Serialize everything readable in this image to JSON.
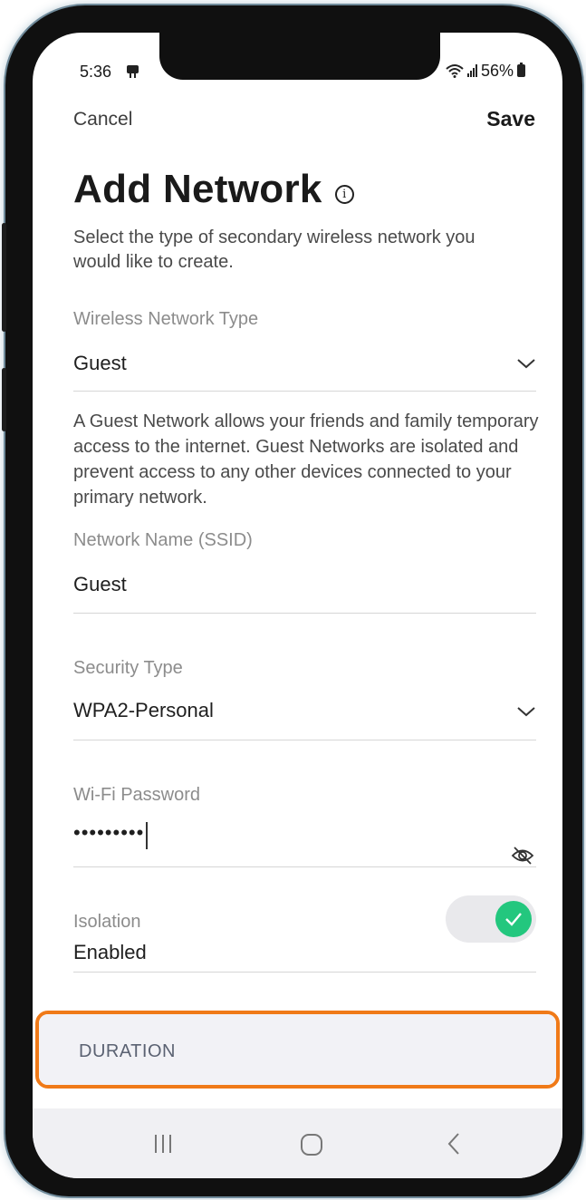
{
  "status_bar": {
    "time": "5:36",
    "battery": "56%",
    "icons": [
      "sim-card-icon",
      "wifi-icon",
      "signal-bars-icon",
      "battery-icon"
    ]
  },
  "header": {
    "cancel_label": "Cancel",
    "save_label": "Save"
  },
  "page": {
    "title": "Add Network",
    "description": "Select the type of secondary wireless network you would like to create."
  },
  "form": {
    "network_type": {
      "label": "Wireless Network Type",
      "value": "Guest"
    },
    "guest_description": "A Guest Network allows your friends and family temporary access to the internet. Guest Networks are isolated and prevent access to any other devices connected to your primary network.",
    "ssid": {
      "label": "Network Name (SSID)",
      "value": "Guest"
    },
    "security_type": {
      "label": "Security Type",
      "value": "WPA2-Personal"
    },
    "password": {
      "label": "Wi-Fi Password",
      "value": "•••••••••"
    },
    "isolation": {
      "label": "Isolation",
      "value": "Enabled",
      "enabled": true
    }
  },
  "duration_section": {
    "label": "DURATION"
  },
  "nav_bar": {
    "buttons": [
      "recent-apps-icon",
      "home-icon",
      "back-icon"
    ]
  },
  "colors": {
    "accent_green": "#23c77e",
    "highlight_orange": "#f07a18"
  }
}
